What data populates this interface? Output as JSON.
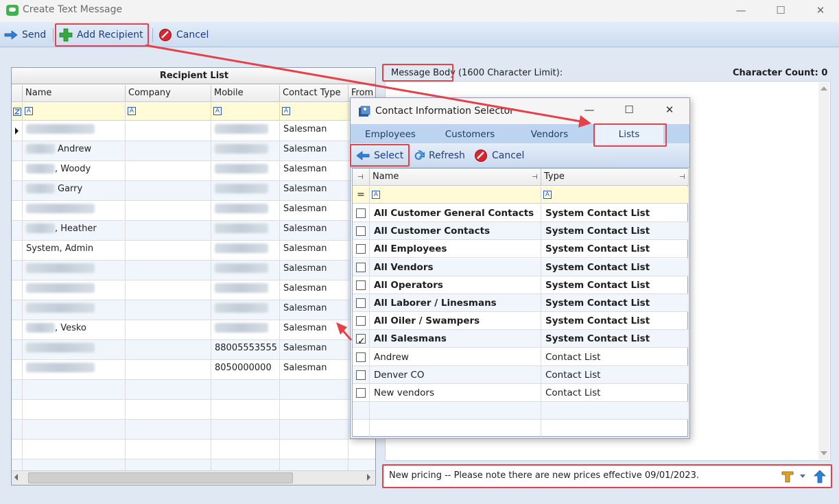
{
  "window": {
    "title": "Create Text Message",
    "minimize_glyph": "—",
    "maximize_glyph": "☐",
    "close_glyph": "✕"
  },
  "toolbar": {
    "send_label": "Send",
    "add_recipient_label": "Add Recipient",
    "cancel_label": "Cancel"
  },
  "recipient_list": {
    "title": "Recipient List",
    "columns": [
      "Name",
      "Company",
      "Mobile",
      "Contact Type",
      "From"
    ],
    "filter_glyph": "A",
    "rows": [
      {
        "name": "",
        "mobile": "",
        "type": "Salesman",
        "current": true
      },
      {
        "name": "Andrew",
        "mobile": "",
        "type": "Salesman"
      },
      {
        "name": ", Woody",
        "mobile": "",
        "type": "Salesman"
      },
      {
        "name": "Garry",
        "mobile": "",
        "type": "Salesman"
      },
      {
        "name": "",
        "mobile": "",
        "type": "Salesman"
      },
      {
        "name": ", Heather",
        "mobile": "",
        "type": "Salesman"
      },
      {
        "name": "System, Admin",
        "mobile": "",
        "type": "Salesman"
      },
      {
        "name": "",
        "mobile": "",
        "type": "Salesman"
      },
      {
        "name": "",
        "mobile": "",
        "type": "Salesman"
      },
      {
        "name": "",
        "mobile": "",
        "type": "Salesman"
      },
      {
        "name": ", Vesko",
        "mobile": "",
        "type": "Salesman"
      },
      {
        "name": "",
        "mobile": "88005553555",
        "type": "Salesman"
      },
      {
        "name": "",
        "mobile": "8050000000",
        "type": "Salesman"
      }
    ],
    "empty_rows": 5
  },
  "message": {
    "body_label": "Message Body",
    "limit_label": "(1600 Character Limit):",
    "char_count_label": "Character Count:",
    "char_count_value": "0",
    "text": "New pricing -- Please note there are new prices effective 09/01/2023."
  },
  "dialog": {
    "title": "Contact Information Selector",
    "tabs": [
      "Employees",
      "Customers",
      "Vendors",
      "Lists"
    ],
    "active_tab": "Lists",
    "toolbar": {
      "select_label": "Select",
      "refresh_label": "Refresh",
      "cancel_label": "Cancel"
    },
    "columns": [
      "Name",
      "Type"
    ],
    "filter_equals": "=",
    "filter_glyph": "A",
    "rows": [
      {
        "name": "All Customer General Contacts",
        "type": "System Contact List",
        "checked": false,
        "system": true
      },
      {
        "name": "All Customer Contacts",
        "type": "System Contact List",
        "checked": false,
        "system": true
      },
      {
        "name": "All Employees",
        "type": "System Contact List",
        "checked": false,
        "system": true
      },
      {
        "name": "All Vendors",
        "type": "System Contact List",
        "checked": false,
        "system": true
      },
      {
        "name": "All Operators",
        "type": "System Contact List",
        "checked": false,
        "system": true
      },
      {
        "name": "All Laborer / Linesmans",
        "type": "System Contact List",
        "checked": false,
        "system": true
      },
      {
        "name": "All Oiler / Swampers",
        "type": "System Contact List",
        "checked": false,
        "system": true
      },
      {
        "name": "All Salesmans",
        "type": "System Contact List",
        "checked": true,
        "system": true
      },
      {
        "name": "Andrew",
        "type": "Contact List",
        "checked": false,
        "system": false
      },
      {
        "name": "Denver CO",
        "type": "Contact List",
        "checked": false,
        "system": false
      },
      {
        "name": "New vendors",
        "type": "Contact List",
        "checked": false,
        "system": false
      }
    ],
    "empty_rows": 2
  },
  "colors": {
    "accent_blue": "#1d3e7a",
    "annotation_red": "#e5414a",
    "filter_yellow": "#fffbd6",
    "tab_strip": "#bcd4ef"
  },
  "icons": {
    "send": "arrow-right-icon",
    "add_recipient": "plus-icon",
    "cancel": "no-entry-icon",
    "select": "arrow-left-icon",
    "refresh": "refresh-icon",
    "spellcheck": "spellcheck-icon",
    "submit": "arrow-up-icon"
  }
}
